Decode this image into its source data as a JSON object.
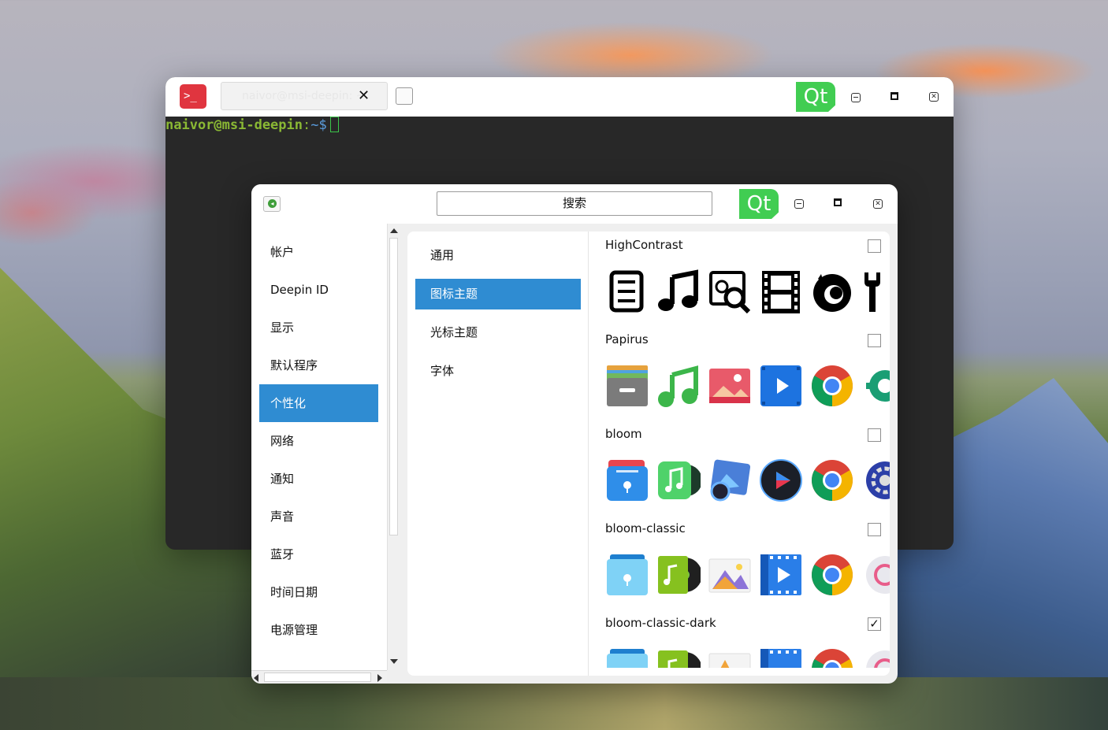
{
  "terminal": {
    "tab_title": "naivor@msi-deepin: ~",
    "qt_label": "Qt",
    "prompt_user": "naivor@msi-deepin",
    "prompt_sep": ":",
    "prompt_path": "~$",
    "app_icon_glyph": ">_"
  },
  "settings": {
    "qt_label": "Qt",
    "search_label": "搜索",
    "nav_items": [
      {
        "label": "帐户"
      },
      {
        "label": "Deepin ID"
      },
      {
        "label": "显示"
      },
      {
        "label": "默认程序"
      },
      {
        "label": "个性化",
        "active": true
      },
      {
        "label": "网络"
      },
      {
        "label": "通知"
      },
      {
        "label": "声音"
      },
      {
        "label": "蓝牙"
      },
      {
        "label": "时间日期"
      },
      {
        "label": "电源管理"
      }
    ],
    "sub_items": [
      {
        "label": "通用"
      },
      {
        "label": "图标主题",
        "active": true
      },
      {
        "label": "光标主题"
      },
      {
        "label": "字体"
      }
    ],
    "themes": [
      {
        "name": "HighContrast",
        "checked": false,
        "icons": [
          "file-manager-icon",
          "music-icon",
          "image-search-icon",
          "film-icon",
          "firefox-icon",
          "wrench-icon"
        ]
      },
      {
        "name": "Papirus",
        "checked": false,
        "icons": [
          "file-manager-icon",
          "music-icon",
          "image-viewer-icon",
          "video-player-icon",
          "chrome-icon",
          "settings-gear-icon"
        ]
      },
      {
        "name": "bloom",
        "checked": false,
        "icons": [
          "file-manager-icon",
          "music-icon",
          "image-viewer-icon",
          "video-player-icon",
          "chrome-icon",
          "settings-gear-icon"
        ]
      },
      {
        "name": "bloom-classic",
        "checked": false,
        "icons": [
          "file-manager-icon",
          "music-icon",
          "image-viewer-icon",
          "video-player-icon",
          "chrome-icon",
          "settings-gear-icon"
        ]
      },
      {
        "name": "bloom-classic-dark",
        "checked": true,
        "check_glyph": "✓",
        "icons": [
          "file-manager-icon",
          "music-icon",
          "image-viewer-icon",
          "video-player-icon",
          "chrome-icon",
          "settings-gear-icon"
        ]
      }
    ]
  },
  "colors": {
    "accent": "#2f8cd2",
    "qt_green": "#41cd52",
    "terminal_bg": "#282828",
    "prompt_green": "#8ab834",
    "prompt_blue": "#5a9ee0"
  }
}
